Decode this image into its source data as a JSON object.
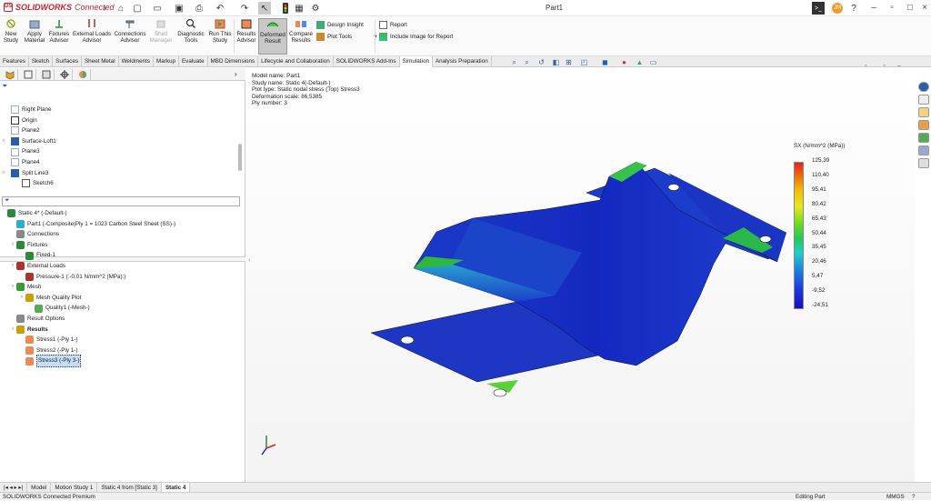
{
  "app": {
    "brand": "SOLIDWORKS",
    "brand_suffix": "Connected",
    "doc_title": "Part1",
    "user_initials": "JM"
  },
  "command_manager": {
    "buttons": [
      {
        "label": "New Study"
      },
      {
        "label": "Apply Material"
      },
      {
        "label": "Fixtures Advisor"
      },
      {
        "label": "External Loads Advisor"
      },
      {
        "label": "Connections Advisor"
      },
      {
        "label": "Shell Manager"
      },
      {
        "label": "Diagnostic Tools"
      },
      {
        "label": "Run This Study"
      },
      {
        "label": "Results Advisor"
      },
      {
        "label": "Deformed Result"
      },
      {
        "label": "Compare Results"
      }
    ],
    "small": [
      {
        "label": "Design Insight"
      },
      {
        "label": "Plot Tools"
      },
      {
        "label": "Report"
      },
      {
        "label": "Include Image for Report"
      }
    ]
  },
  "tabs": [
    "Features",
    "Sketch",
    "Surfaces",
    "Sheet Metal",
    "Weldments",
    "Markup",
    "Evaluate",
    "MBD Dimensions",
    "Lifecycle and Collaboration",
    "SOLIDWORKS Add-Ins",
    "Simulation",
    "Analysis Preparation"
  ],
  "active_tab": "Simulation",
  "feature_tree": [
    "Right Plane",
    "Origin",
    "Plane2",
    "Surface-Loft1",
    "Plane3",
    "Plane4",
    "Split Line3",
    "Sketch6"
  ],
  "sim_tree": {
    "study": "Static 4* (-Default-)",
    "part": "Part1 (-Composite|Ply 1 = 1023 Carbon Steel Sheet (SS)-)",
    "connections": "Connections",
    "fixtures": "Fixtures",
    "fixed": "Fixed-1",
    "external_loads": "External Loads",
    "pressure": "Pressure-1 (:-0,01 N/mm^2 (MPa):)",
    "mesh": "Mesh",
    "mesh_quality_plot": "Mesh Quality Plot",
    "quality1": "Quality1 (-Mesh-)",
    "result_options": "Result Options",
    "results": "Results",
    "stress1": "Stress1 (-Ply 1-)",
    "stress2": "Stress2 (-Ply 1-)",
    "stress3": "Stress3 (-Ply 3-)"
  },
  "viewport_info": [
    "Model name: Part1",
    "Study name: Static 4(-Default-)",
    "Plot type: Static nodal stress (Top) Stress3",
    "Deformation scale: 86,5385",
    "Ply number: 3"
  ],
  "legend": {
    "title": "SX (N/mm^2 (MPa))",
    "ticks": [
      "125,39",
      "110,40",
      "95,41",
      "80,42",
      "65,43",
      "50,44",
      "35,45",
      "20,46",
      "5,47",
      "-9,52",
      "-24,51"
    ]
  },
  "bottom_tabs": [
    "Model",
    "Motion Study 1",
    "Static 4 from [Static 3]",
    "Static 4"
  ],
  "active_bottom_tab": "Static 4",
  "status": {
    "left": "SOLIDWORKS Connected Premium",
    "mode": "Editing Part",
    "units": "MMGS"
  },
  "colors": {
    "brand": "#d11f2a",
    "accent": "#2a5fa8",
    "model_blue": "#1a2fc8",
    "legend_max": "#e8211a",
    "legend_min": "#1212c0"
  }
}
